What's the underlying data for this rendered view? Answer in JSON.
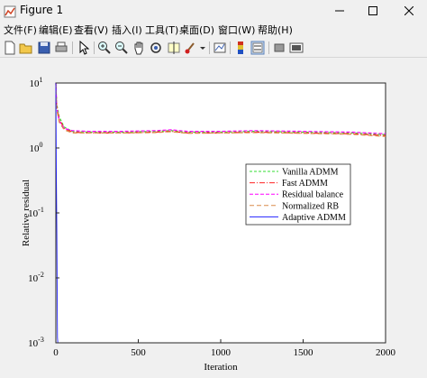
{
  "window": {
    "title": "Figure 1",
    "controls": [
      "minimize",
      "maximize",
      "close"
    ]
  },
  "menubar": {
    "items": [
      "文件(F)",
      "编辑(E)",
      "查看(V)",
      "插入(I)",
      "工具(T)",
      "桌面(D)",
      "窗口(W)",
      "帮助(H)"
    ]
  },
  "toolbar": {
    "icons": [
      "new-figure-icon",
      "open-file-icon",
      "save-icon",
      "print-icon",
      "pointer-icon",
      "zoom-in-icon",
      "zoom-out-icon",
      "pan-hand-icon",
      "rotate-3d-icon",
      "data-cursor-icon",
      "brush-icon",
      "brush-dropdown-icon",
      "link-plot-icon",
      "colorbar-icon",
      "legend-icon",
      "hide-plot-tools-icon",
      "show-plot-tools-icon"
    ]
  },
  "chart_data": {
    "type": "line",
    "xlabel": "Iteration",
    "ylabel": "Relative residual",
    "xlim": [
      0,
      2000
    ],
    "ylim": [
      0.001,
      10
    ],
    "yscale": "log",
    "xticks": [
      "0",
      "500",
      "1000",
      "1500",
      "2000"
    ],
    "yticks": [
      {
        "base": "10",
        "exp": "1"
      },
      {
        "base": "10",
        "exp": "0"
      },
      {
        "base": "10",
        "exp": "-1"
      },
      {
        "base": "10",
        "exp": "-2"
      },
      {
        "base": "10",
        "exp": "-3"
      }
    ],
    "legend_position": "right",
    "series": [
      {
        "name": "Vanilla ADMM",
        "color": "#33dd33",
        "dash": "3,2",
        "x": [
          0,
          5,
          20,
          50,
          100,
          200,
          400,
          600,
          700,
          800,
          1000,
          1200,
          1500,
          1800,
          2000
        ],
        "y": [
          10,
          4.8,
          3.0,
          2.1,
          1.8,
          1.75,
          1.75,
          1.8,
          1.85,
          1.75,
          1.75,
          1.8,
          1.75,
          1.7,
          1.6
        ]
      },
      {
        "name": "Fast ADMM",
        "color": "#ff2222",
        "dash": "6,2,1,2",
        "x": [
          0,
          5,
          20,
          50,
          100,
          200,
          400,
          600,
          700,
          800,
          1000,
          1200,
          1500,
          1800,
          2000
        ],
        "y": [
          10,
          4.5,
          2.8,
          2.0,
          1.75,
          1.7,
          1.7,
          1.75,
          1.8,
          1.7,
          1.7,
          1.75,
          1.7,
          1.65,
          1.55
        ]
      },
      {
        "name": "Residual balance",
        "color": "#ff00ff",
        "dash": "4,2",
        "x": [
          0,
          5,
          20,
          50,
          100,
          200,
          400,
          600,
          700,
          800,
          1000,
          1200,
          1500,
          1800,
          2000
        ],
        "y": [
          10,
          4.2,
          2.6,
          2.0,
          1.85,
          1.8,
          1.8,
          1.85,
          1.9,
          1.8,
          1.8,
          1.85,
          1.8,
          1.75,
          1.65
        ]
      },
      {
        "name": "Normalized RB",
        "color": "#d98c4a",
        "dash": "5,3",
        "x": [
          0,
          5,
          20,
          50,
          100,
          200,
          400,
          600,
          700,
          800,
          1000,
          1200,
          1500,
          1800,
          2000
        ],
        "y": [
          10,
          4.0,
          2.5,
          1.9,
          1.7,
          1.7,
          1.7,
          1.72,
          1.78,
          1.68,
          1.7,
          1.72,
          1.68,
          1.62,
          1.5
        ]
      },
      {
        "name": "Adaptive ADMM",
        "color": "#2222ff",
        "dash": "",
        "x": [
          0,
          1,
          3,
          6,
          8,
          10,
          12
        ],
        "y": [
          10,
          3,
          0.5,
          0.05,
          0.005,
          0.0012,
          0.001
        ]
      }
    ]
  }
}
